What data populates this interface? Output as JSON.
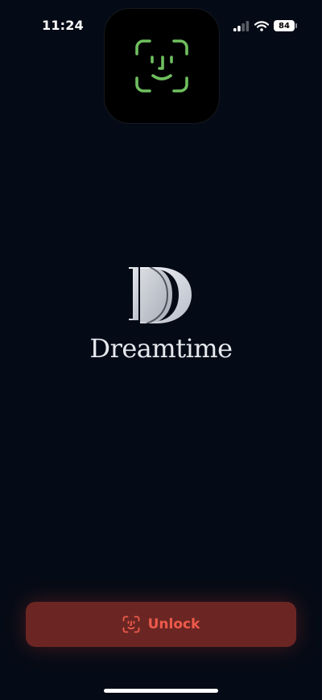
{
  "status_bar": {
    "time": "11:24",
    "battery_percent": "84",
    "signal_bars_filled": 2,
    "signal_bars_total": 4,
    "icons": [
      "cellular-signal-icon",
      "wifi-icon",
      "battery-icon"
    ]
  },
  "faceid_overlay": {
    "icon": "face-id-icon",
    "color": "#6fbf5f"
  },
  "brand": {
    "logo_letter": "D",
    "name": "Dreamtime"
  },
  "unlock_button": {
    "label": "Unlock",
    "icon": "face-id-icon",
    "color": "#ee5a4b",
    "background": "#6b2623"
  },
  "colors": {
    "background": "#050b16"
  }
}
